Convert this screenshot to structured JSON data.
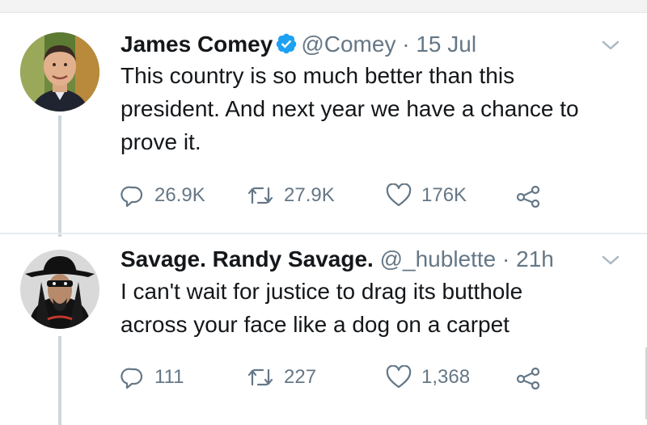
{
  "tweets": [
    {
      "author_name": "James Comey",
      "verified": true,
      "handle": "@Comey",
      "separator": "·",
      "time": "15 Jul",
      "lines": [
        "This country is so much better than this",
        "president.  And next year we have a chance to",
        "prove it."
      ],
      "stats": {
        "replies": "26.9K",
        "retweets": "27.9K",
        "likes": "176K"
      },
      "icons": {
        "reply": "reply-icon",
        "retweet": "retweet-icon",
        "like": "heart-icon",
        "share": "share-icon",
        "menu": "chevron-down-icon"
      }
    },
    {
      "author_name": "Savage. Randy Savage.",
      "verified": false,
      "handle": "@_hublette",
      "separator": "·",
      "time": "21h",
      "lines": [
        "I can't wait for justice to drag its butthole",
        "across your face like a dog on a carpet"
      ],
      "stats": {
        "replies": "111",
        "retweets": "227",
        "likes": "1,368"
      },
      "icons": {
        "reply": "reply-icon",
        "retweet": "retweet-icon",
        "like": "heart-icon",
        "share": "share-icon",
        "menu": "chevron-down-icon"
      }
    }
  ],
  "colors": {
    "text": "#14171a",
    "secondary": "#657786",
    "verified": "#1da1f2",
    "thread_line": "#ccd6dd"
  }
}
